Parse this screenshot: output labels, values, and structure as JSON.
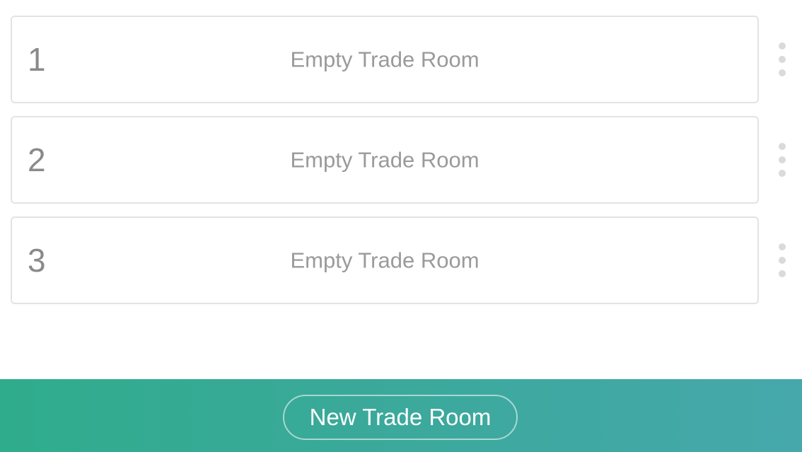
{
  "rooms": [
    {
      "number": "1",
      "label": "Empty Trade Room",
      "menu_icon": "more-vertical-icon"
    },
    {
      "number": "2",
      "label": "Empty Trade Room",
      "menu_icon": "more-vertical-icon"
    },
    {
      "number": "3",
      "label": "Empty Trade Room",
      "menu_icon": "more-vertical-icon"
    }
  ],
  "footer": {
    "new_room_label": "New Trade Room"
  },
  "colors": {
    "footer_gradient_start": "#2fac8c",
    "footer_gradient_end": "#46a8ab",
    "card_border": "#e3e3e3",
    "text_muted": "#9a9a9a",
    "menu_dot": "#dadada"
  }
}
